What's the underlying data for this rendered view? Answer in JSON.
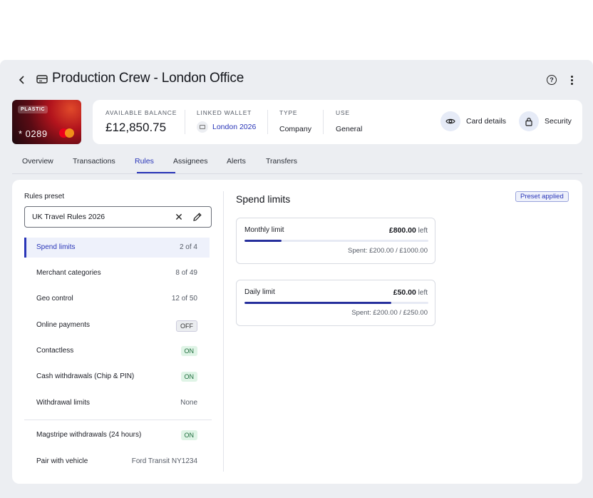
{
  "header": {
    "title": "Production Crew - London Office",
    "back_icon": "chevron-left-icon",
    "title_icon": "card-icon",
    "help_icon": "help-circle-icon",
    "more_icon": "more-vertical-icon"
  },
  "card": {
    "badge": "PLASTIC",
    "number": "* 0289",
    "brand_icon": "mastercard-logo"
  },
  "info": {
    "balance_label": "AVAILABLE BALANCE",
    "balance_value": "£12,850.75",
    "wallet_label": "LINKED WALLET",
    "wallet_value": "London 2026",
    "type_label": "TYPE",
    "type_value": "Company",
    "use_label": "USE",
    "use_value": "General",
    "card_details_label": "Card details",
    "security_label": "Security"
  },
  "tabs": [
    "Overview",
    "Transactions",
    "Rules",
    "Assignees",
    "Alerts",
    "Transfers"
  ],
  "active_tab": "Rules",
  "rules": {
    "preset_label": "Rules preset",
    "preset_value": "UK Travel Rules 2026",
    "items": [
      {
        "name": "Spend limits",
        "value": "2 of 4"
      },
      {
        "name": "Merchant categories",
        "value": "8 of 49"
      },
      {
        "name": "Geo control",
        "value": "12 of 50"
      },
      {
        "name": "Online payments",
        "value": "OFF"
      },
      {
        "name": "Contactless",
        "value": "ON"
      },
      {
        "name": "Cash withdrawals (Chip & PIN)",
        "value": "ON"
      },
      {
        "name": "Withdrawal limits",
        "value": "None"
      },
      {
        "name": "Magstripe withdrawals (24 hours)",
        "value": "ON"
      },
      {
        "name": "Pair with vehicle",
        "value": "Ford Transit NY1234"
      }
    ]
  },
  "spend_limits": {
    "title": "Spend limits",
    "preset_badge": "Preset applied",
    "monthly": {
      "label": "Monthly limit",
      "amount": "£800.00",
      "suffix": "left",
      "spent": "Spent: £200.00 / £1000.00",
      "progress": 0.2
    },
    "daily": {
      "label": "Daily limit",
      "amount": "£50.00",
      "suffix": "left",
      "spent": "Spent: £200.00 / £250.00",
      "progress": 0.8
    }
  },
  "colors": {
    "accent": "#2a36b8",
    "on_badge": "#dff4e6",
    "background": "#eceef2"
  }
}
